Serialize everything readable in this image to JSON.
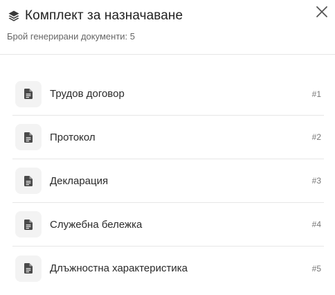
{
  "dialog": {
    "title": "Комплект за назначаване",
    "subtitle": "Брой генерирани документи: 5",
    "title_icon": "layers-icon",
    "close_icon": "close-icon"
  },
  "documents": [
    {
      "label": "Трудов договор",
      "number": "#1",
      "icon": "file-document-icon"
    },
    {
      "label": "Протокол",
      "number": "#2",
      "icon": "file-document-icon"
    },
    {
      "label": "Декларация",
      "number": "#3",
      "icon": "file-document-icon"
    },
    {
      "label": "Служебна бележка",
      "number": "#4",
      "icon": "file-document-icon"
    },
    {
      "label": "Длъжностна характеристика",
      "number": "#5",
      "icon": "file-document-icon"
    }
  ],
  "colors": {
    "icon_fill": "#4a4a4a",
    "icon_bg": "#f3f3f3",
    "divider": "#e6e6e6"
  }
}
